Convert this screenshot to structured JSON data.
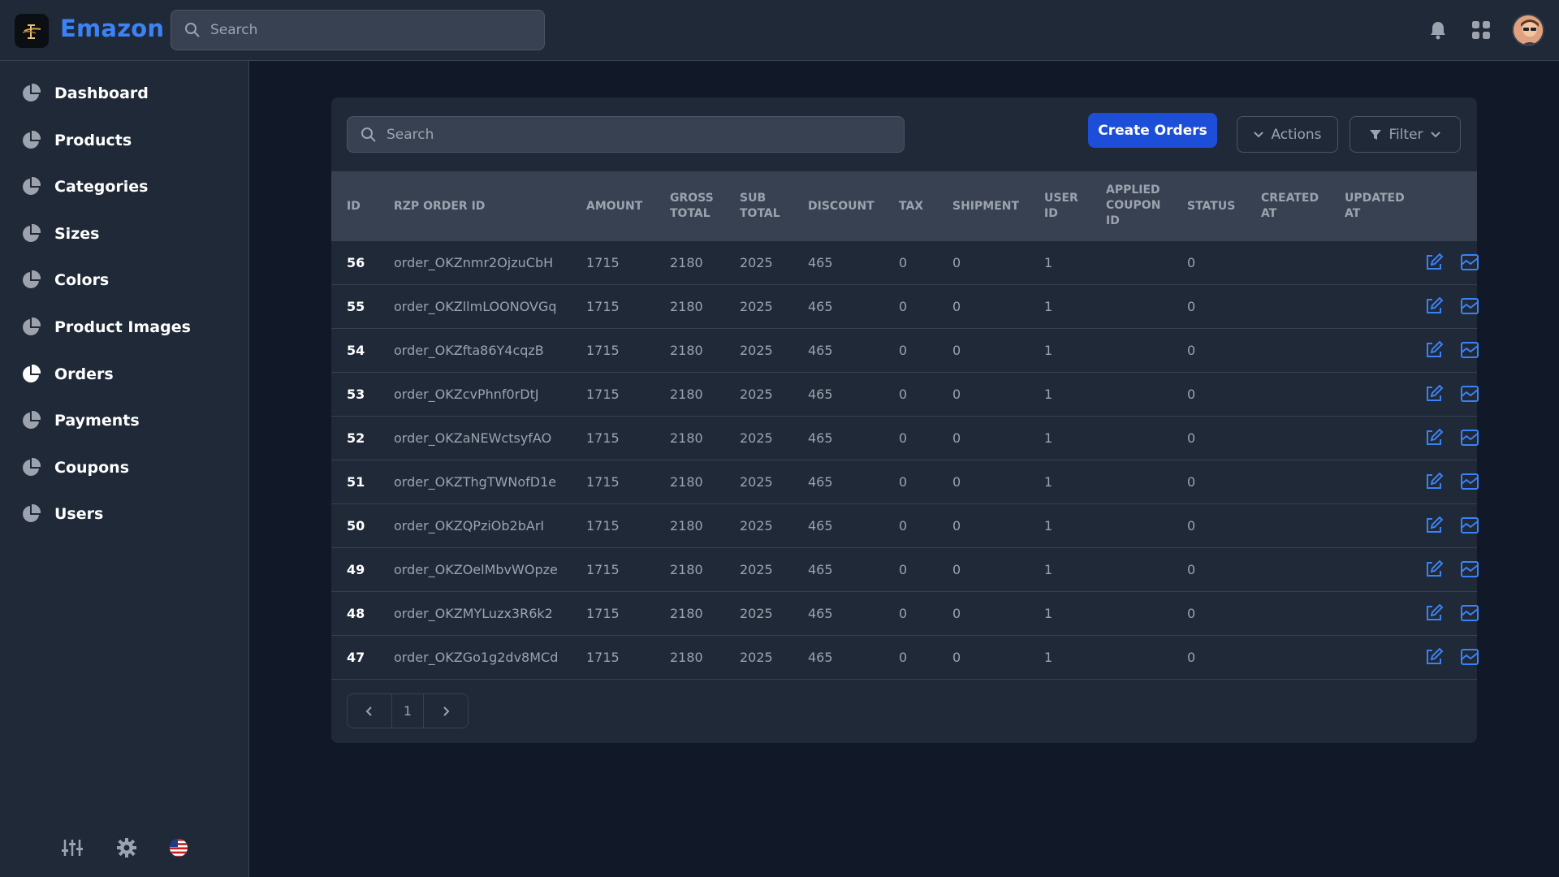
{
  "app": {
    "brand": "Emazon",
    "search_placeholder": "Search"
  },
  "sidebar": {
    "items": [
      {
        "label": "Dashboard",
        "icon": "pie-chart-icon",
        "active": false
      },
      {
        "label": "Products",
        "icon": "pie-chart-icon",
        "active": false
      },
      {
        "label": "Categories",
        "icon": "pie-chart-icon",
        "active": false
      },
      {
        "label": "Sizes",
        "icon": "pie-chart-icon",
        "active": false
      },
      {
        "label": "Colors",
        "icon": "pie-chart-icon",
        "active": false
      },
      {
        "label": "Product Images",
        "icon": "pie-chart-icon",
        "active": false
      },
      {
        "label": "Orders",
        "icon": "pie-chart-icon",
        "active": true
      },
      {
        "label": "Payments",
        "icon": "pie-chart-icon",
        "active": false
      },
      {
        "label": "Coupons",
        "icon": "pie-chart-icon",
        "active": false
      },
      {
        "label": "Users",
        "icon": "pie-chart-icon",
        "active": false
      }
    ],
    "bottom_icons": [
      "sliders-icon",
      "gear-icon",
      "us-flag-icon"
    ]
  },
  "toolbar": {
    "search_placeholder": "Search",
    "create_label": "Create Orders",
    "actions_label": "Actions",
    "filter_label": "Filter"
  },
  "table": {
    "headers": {
      "id": "ID",
      "rzp": "RZP ORDER ID",
      "amount": "AMOUNT",
      "gross_1": "GROSS",
      "gross_2": "TOTAL",
      "sub_1": "SUB",
      "sub_2": "TOTAL",
      "discount": "DISCOUNT",
      "tax": "TAX",
      "shipment": "SHIPMENT",
      "user_1": "USER",
      "user_2": "ID",
      "coupon_1": "APPLIED",
      "coupon_2": "COUPON",
      "coupon_3": "ID",
      "status": "STATUS",
      "created_1": "CREATED",
      "created_2": "AT",
      "updated_1": "UPDATED",
      "updated_2": "AT"
    },
    "rows": [
      {
        "id": "56",
        "rzp": "order_OKZnmr2OjzuCbH",
        "amount": "1715",
        "gross": "2180",
        "sub": "2025",
        "discount": "465",
        "tax": "0",
        "shipment": "0",
        "user": "1",
        "status": "0"
      },
      {
        "id": "55",
        "rzp": "order_OKZllmLOONOVGq",
        "amount": "1715",
        "gross": "2180",
        "sub": "2025",
        "discount": "465",
        "tax": "0",
        "shipment": "0",
        "user": "1",
        "status": "0"
      },
      {
        "id": "54",
        "rzp": "order_OKZfta86Y4cqzB",
        "amount": "1715",
        "gross": "2180",
        "sub": "2025",
        "discount": "465",
        "tax": "0",
        "shipment": "0",
        "user": "1",
        "status": "0"
      },
      {
        "id": "53",
        "rzp": "order_OKZcvPhnf0rDtJ",
        "amount": "1715",
        "gross": "2180",
        "sub": "2025",
        "discount": "465",
        "tax": "0",
        "shipment": "0",
        "user": "1",
        "status": "0"
      },
      {
        "id": "52",
        "rzp": "order_OKZaNEWctsyfAO",
        "amount": "1715",
        "gross": "2180",
        "sub": "2025",
        "discount": "465",
        "tax": "0",
        "shipment": "0",
        "user": "1",
        "status": "0"
      },
      {
        "id": "51",
        "rzp": "order_OKZThgTWNofD1e",
        "amount": "1715",
        "gross": "2180",
        "sub": "2025",
        "discount": "465",
        "tax": "0",
        "shipment": "0",
        "user": "1",
        "status": "0"
      },
      {
        "id": "50",
        "rzp": "order_OKZQPziOb2bArI",
        "amount": "1715",
        "gross": "2180",
        "sub": "2025",
        "discount": "465",
        "tax": "0",
        "shipment": "0",
        "user": "1",
        "status": "0"
      },
      {
        "id": "49",
        "rzp": "order_OKZOelMbvWOpze",
        "amount": "1715",
        "gross": "2180",
        "sub": "2025",
        "discount": "465",
        "tax": "0",
        "shipment": "0",
        "user": "1",
        "status": "0"
      },
      {
        "id": "48",
        "rzp": "order_OKZMYLuzx3R6k2",
        "amount": "1715",
        "gross": "2180",
        "sub": "2025",
        "discount": "465",
        "tax": "0",
        "shipment": "0",
        "user": "1",
        "status": "0"
      },
      {
        "id": "47",
        "rzp": "order_OKZGo1g2dv8MCd",
        "amount": "1715",
        "gross": "2180",
        "sub": "2025",
        "discount": "465",
        "tax": "0",
        "shipment": "0",
        "user": "1",
        "status": "0"
      }
    ]
  },
  "pagination": {
    "current_page": "1"
  },
  "colors": {
    "accent": "#1d4ed8",
    "brand": "#3b82f6",
    "background": "#111827",
    "surface": "#1f2937"
  }
}
